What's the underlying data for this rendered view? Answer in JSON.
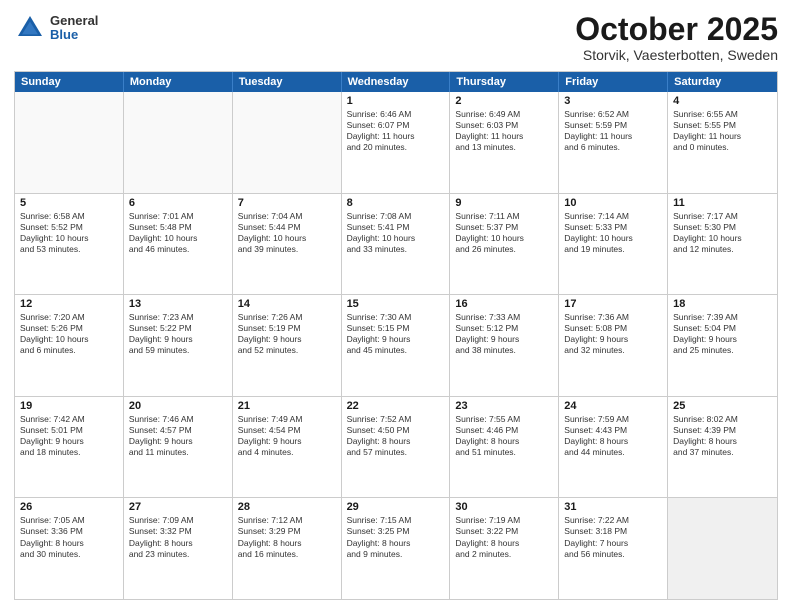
{
  "header": {
    "logo": {
      "general": "General",
      "blue": "Blue"
    },
    "title": "October 2025",
    "location": "Storvik, Vaesterbotten, Sweden"
  },
  "weekdays": [
    "Sunday",
    "Monday",
    "Tuesday",
    "Wednesday",
    "Thursday",
    "Friday",
    "Saturday"
  ],
  "rows": [
    [
      {
        "day": "",
        "info": "",
        "empty": true
      },
      {
        "day": "",
        "info": "",
        "empty": true
      },
      {
        "day": "",
        "info": "",
        "empty": true
      },
      {
        "day": "1",
        "info": "Sunrise: 6:46 AM\nSunset: 6:07 PM\nDaylight: 11 hours\nand 20 minutes."
      },
      {
        "day": "2",
        "info": "Sunrise: 6:49 AM\nSunset: 6:03 PM\nDaylight: 11 hours\nand 13 minutes."
      },
      {
        "day": "3",
        "info": "Sunrise: 6:52 AM\nSunset: 5:59 PM\nDaylight: 11 hours\nand 6 minutes."
      },
      {
        "day": "4",
        "info": "Sunrise: 6:55 AM\nSunset: 5:55 PM\nDaylight: 11 hours\nand 0 minutes."
      }
    ],
    [
      {
        "day": "5",
        "info": "Sunrise: 6:58 AM\nSunset: 5:52 PM\nDaylight: 10 hours\nand 53 minutes."
      },
      {
        "day": "6",
        "info": "Sunrise: 7:01 AM\nSunset: 5:48 PM\nDaylight: 10 hours\nand 46 minutes."
      },
      {
        "day": "7",
        "info": "Sunrise: 7:04 AM\nSunset: 5:44 PM\nDaylight: 10 hours\nand 39 minutes."
      },
      {
        "day": "8",
        "info": "Sunrise: 7:08 AM\nSunset: 5:41 PM\nDaylight: 10 hours\nand 33 minutes."
      },
      {
        "day": "9",
        "info": "Sunrise: 7:11 AM\nSunset: 5:37 PM\nDaylight: 10 hours\nand 26 minutes."
      },
      {
        "day": "10",
        "info": "Sunrise: 7:14 AM\nSunset: 5:33 PM\nDaylight: 10 hours\nand 19 minutes."
      },
      {
        "day": "11",
        "info": "Sunrise: 7:17 AM\nSunset: 5:30 PM\nDaylight: 10 hours\nand 12 minutes."
      }
    ],
    [
      {
        "day": "12",
        "info": "Sunrise: 7:20 AM\nSunset: 5:26 PM\nDaylight: 10 hours\nand 6 minutes."
      },
      {
        "day": "13",
        "info": "Sunrise: 7:23 AM\nSunset: 5:22 PM\nDaylight: 9 hours\nand 59 minutes."
      },
      {
        "day": "14",
        "info": "Sunrise: 7:26 AM\nSunset: 5:19 PM\nDaylight: 9 hours\nand 52 minutes."
      },
      {
        "day": "15",
        "info": "Sunrise: 7:30 AM\nSunset: 5:15 PM\nDaylight: 9 hours\nand 45 minutes."
      },
      {
        "day": "16",
        "info": "Sunrise: 7:33 AM\nSunset: 5:12 PM\nDaylight: 9 hours\nand 38 minutes."
      },
      {
        "day": "17",
        "info": "Sunrise: 7:36 AM\nSunset: 5:08 PM\nDaylight: 9 hours\nand 32 minutes."
      },
      {
        "day": "18",
        "info": "Sunrise: 7:39 AM\nSunset: 5:04 PM\nDaylight: 9 hours\nand 25 minutes."
      }
    ],
    [
      {
        "day": "19",
        "info": "Sunrise: 7:42 AM\nSunset: 5:01 PM\nDaylight: 9 hours\nand 18 minutes."
      },
      {
        "day": "20",
        "info": "Sunrise: 7:46 AM\nSunset: 4:57 PM\nDaylight: 9 hours\nand 11 minutes."
      },
      {
        "day": "21",
        "info": "Sunrise: 7:49 AM\nSunset: 4:54 PM\nDaylight: 9 hours\nand 4 minutes."
      },
      {
        "day": "22",
        "info": "Sunrise: 7:52 AM\nSunset: 4:50 PM\nDaylight: 8 hours\nand 57 minutes."
      },
      {
        "day": "23",
        "info": "Sunrise: 7:55 AM\nSunset: 4:46 PM\nDaylight: 8 hours\nand 51 minutes."
      },
      {
        "day": "24",
        "info": "Sunrise: 7:59 AM\nSunset: 4:43 PM\nDaylight: 8 hours\nand 44 minutes."
      },
      {
        "day": "25",
        "info": "Sunrise: 8:02 AM\nSunset: 4:39 PM\nDaylight: 8 hours\nand 37 minutes."
      }
    ],
    [
      {
        "day": "26",
        "info": "Sunrise: 7:05 AM\nSunset: 3:36 PM\nDaylight: 8 hours\nand 30 minutes."
      },
      {
        "day": "27",
        "info": "Sunrise: 7:09 AM\nSunset: 3:32 PM\nDaylight: 8 hours\nand 23 minutes."
      },
      {
        "day": "28",
        "info": "Sunrise: 7:12 AM\nSunset: 3:29 PM\nDaylight: 8 hours\nand 16 minutes."
      },
      {
        "day": "29",
        "info": "Sunrise: 7:15 AM\nSunset: 3:25 PM\nDaylight: 8 hours\nand 9 minutes."
      },
      {
        "day": "30",
        "info": "Sunrise: 7:19 AM\nSunset: 3:22 PM\nDaylight: 8 hours\nand 2 minutes."
      },
      {
        "day": "31",
        "info": "Sunrise: 7:22 AM\nSunset: 3:18 PM\nDaylight: 7 hours\nand 56 minutes."
      },
      {
        "day": "",
        "info": "",
        "empty": true,
        "shaded": true
      }
    ]
  ]
}
